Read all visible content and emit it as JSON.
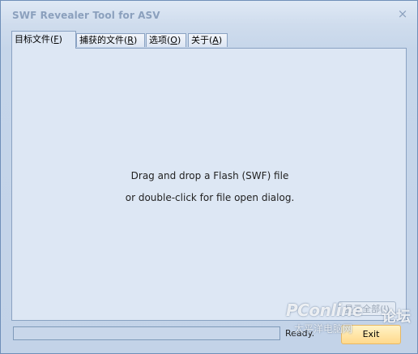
{
  "window": {
    "title": "SWF Revealer Tool for ASV",
    "close_glyph": "×"
  },
  "tabs": [
    {
      "label": "目标文件",
      "mnemonic": "F"
    },
    {
      "label": "捕获的文件",
      "mnemonic": "R"
    },
    {
      "label": "选项",
      "mnemonic": "O"
    },
    {
      "label": "关于",
      "mnemonic": "A"
    }
  ],
  "panel": {
    "line1": "Drag and drop a Flash (SWF) file",
    "line2": "or double-click for file open dialog.",
    "show_all_label": "显示全部(I)"
  },
  "footer": {
    "status": "Ready.",
    "exit_label": "Exit"
  },
  "watermark": {
    "brand": "PConline",
    "forum": "论坛",
    "site": "太平洋电脑网"
  },
  "colors": {
    "title_text": "#8ba0bd",
    "window_bg": "#c6d6ea",
    "exit_bg": "#ffd98c"
  }
}
